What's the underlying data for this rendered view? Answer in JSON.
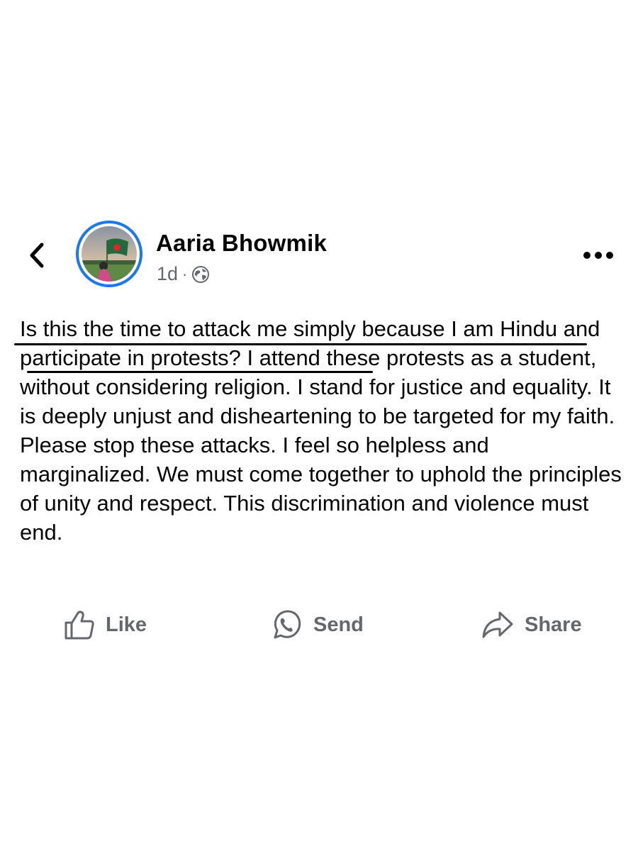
{
  "header": {
    "back_icon": "chevron-left-icon",
    "author_name": "Aaria Bhowmik",
    "timestamp": "1d",
    "separator": "·",
    "audience_icon": "globe-icon",
    "more_icon": "more-horizontal-icon"
  },
  "post": {
    "text": "Is this the time to attack me simply because I am Hindu and participate in protests? I attend these protests as a student, without considering religion. I stand for justice and equality. It is deeply unjust and disheartening to be targeted for my faith. Please stop these attacks. I feel so helpless and marginalized. We must come together to uphold the principles of unity and respect. This discrimination and violence must end."
  },
  "actions": {
    "like_label": "Like",
    "like_icon": "thumbs-up-icon",
    "send_label": "Send",
    "send_icon": "whatsapp-icon",
    "share_label": "Share",
    "share_icon": "share-arrow-icon"
  },
  "colors": {
    "accent": "#1877f2",
    "text_primary": "#050505",
    "text_secondary": "#65676b",
    "background": "#ffffff"
  }
}
